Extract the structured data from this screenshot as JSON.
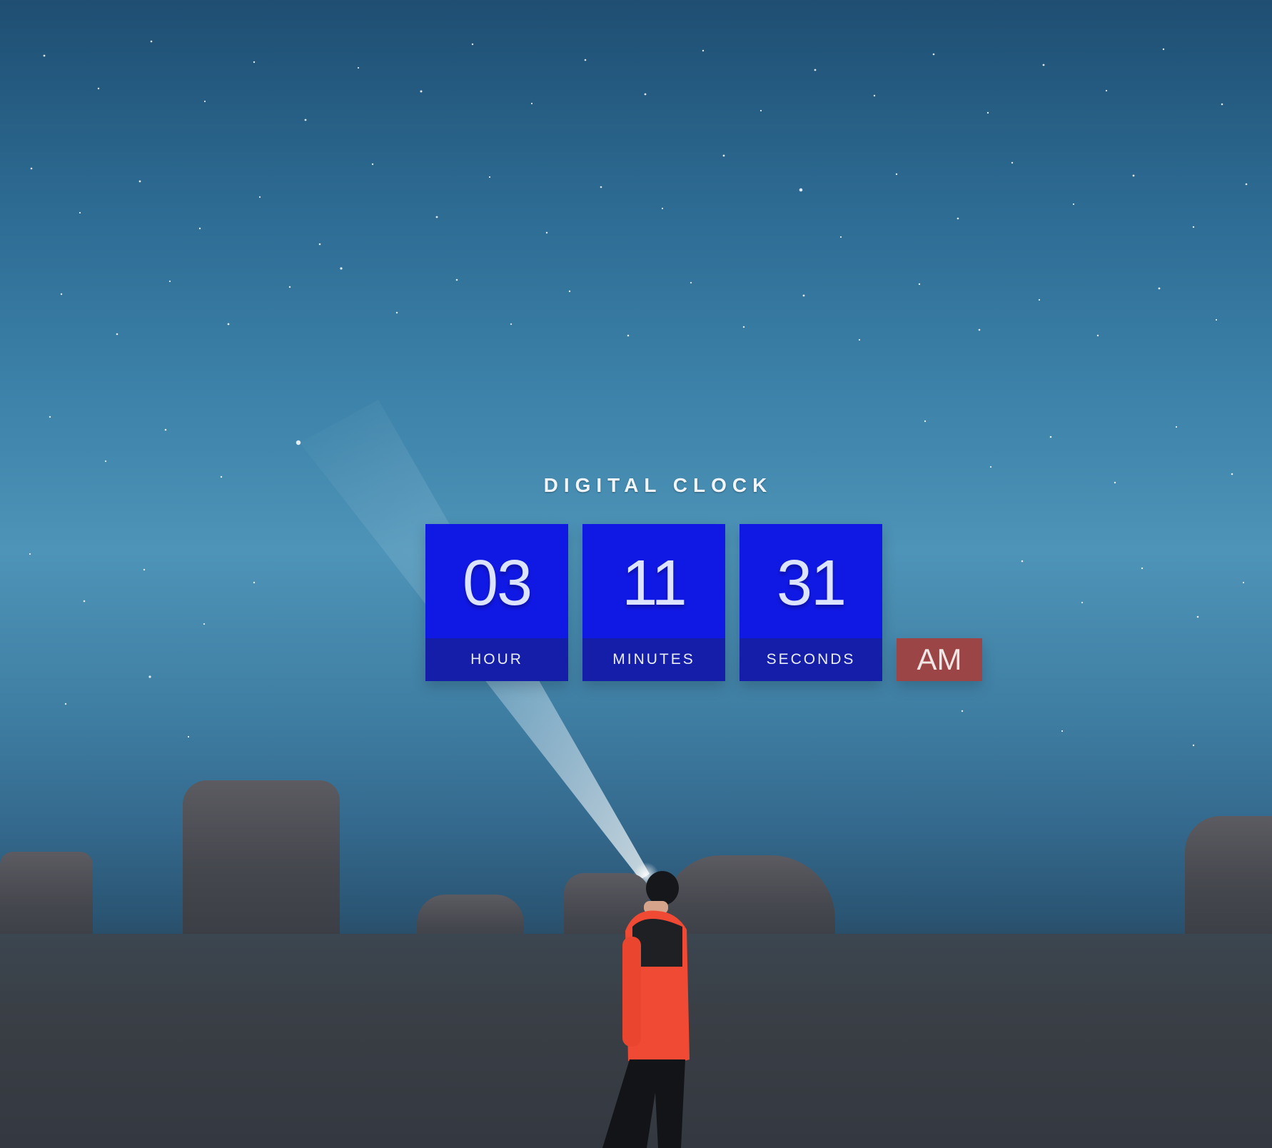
{
  "title": "DIGITAL CLOCK",
  "clock": {
    "hour": "03",
    "minutes": "11",
    "seconds": "31",
    "period": "AM"
  },
  "labels": {
    "hour": "HOUR",
    "minutes": "MINUTES",
    "seconds": "SECONDS"
  },
  "colors": {
    "value_box": "#1018e3",
    "label_box": "#151ea8",
    "ampm_box": "#9b4547",
    "text": "#dce3ff"
  }
}
